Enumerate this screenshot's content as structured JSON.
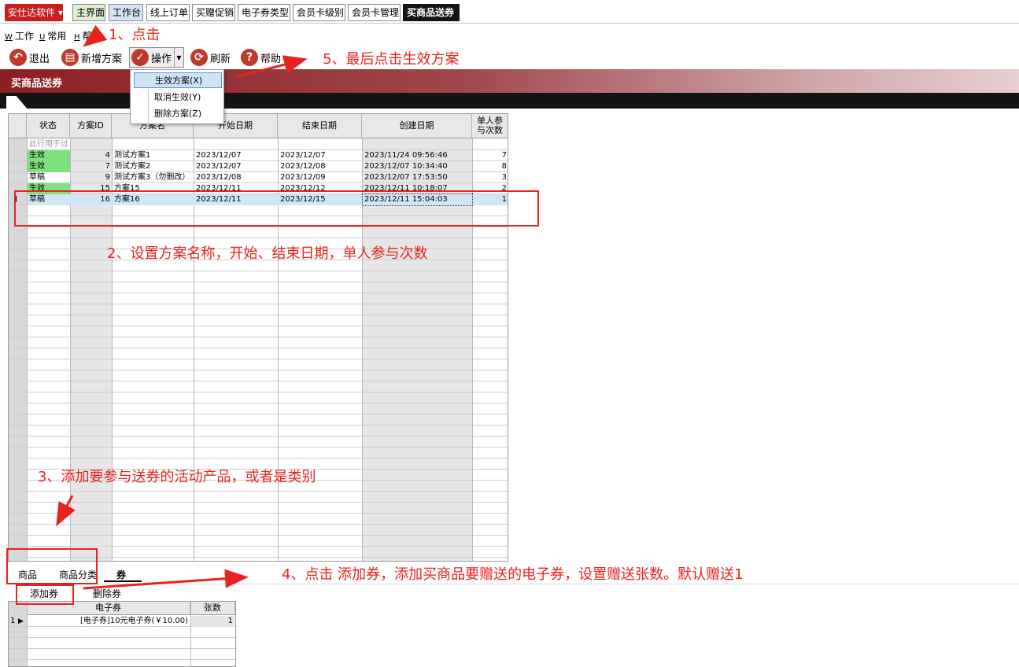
{
  "brand": "安仕达软件",
  "tabs": [
    "主界面",
    "工作台",
    "线上订单",
    "买赠促销",
    "电子券类型",
    "会员卡级别",
    "会员卡管理",
    "买商品送券"
  ],
  "menu": {
    "work": {
      "key": "W",
      "label": "工作"
    },
    "common": {
      "key": "U",
      "label": "常用"
    },
    "help": {
      "key": "H",
      "label": "帮助"
    }
  },
  "toolbar": {
    "exit": "退出",
    "new_plan": "新增方案",
    "operation": "操作",
    "refresh": "刷新",
    "help": "帮助"
  },
  "operation_menu": [
    "生效方案(X)",
    "取消生效(Y)",
    "删除方案(Z)"
  ],
  "panel_title": "买商品送券",
  "grid": {
    "columns": [
      "状态",
      "方案ID",
      "方案名",
      "开始日期",
      "结束日期",
      "创建日期",
      "单人参与次数"
    ],
    "filter_hint": "此行用于过",
    "current_row_marker": "I",
    "rows": [
      {
        "status": "生效",
        "id": "4",
        "name": "测试方案1",
        "start": "2023/12/07",
        "end": "2023/12/07",
        "created": "2023/11/24 09:56:46",
        "times": "7"
      },
      {
        "status": "生效",
        "id": "7",
        "name": "测试方案2",
        "start": "2023/12/07",
        "end": "2023/12/08",
        "created": "2023/12/07 10:34:40",
        "times": "8"
      },
      {
        "status": "草稿",
        "id": "9",
        "name": "测试方案3（勿删改）",
        "start": "2023/12/08",
        "end": "2023/12/09",
        "created": "2023/12/07 17:53:50",
        "times": "3"
      },
      {
        "status": "生效",
        "id": "15",
        "name": "方案15",
        "start": "2023/12/11",
        "end": "2023/12/12",
        "created": "2023/12/11 10:18:07",
        "times": "2"
      },
      {
        "status": "草稿",
        "id": "16",
        "name": "方案16",
        "start": "2023/12/11",
        "end": "2023/12/15",
        "created": "2023/12/11 15:04:03",
        "times": "1"
      }
    ]
  },
  "lower_tabs": [
    "商品",
    "商品分类",
    "券"
  ],
  "lower_toolbar": {
    "add": "添加券",
    "delete": "删除券"
  },
  "voucher_grid": {
    "columns": [
      "电子券",
      "张数"
    ],
    "rows": [
      {
        "idx": "1",
        "voucher": "[电子券]10元电子券(￥10.00)",
        "count": "1"
      }
    ]
  },
  "annotations": {
    "a1": "1、点击",
    "a2": "2、设置方案名称，开始、结束日期，单人参与次数",
    "a3": "3、添加要参与送券的活动产品，或者是类别",
    "a4": "4、点击 添加券，添加买商品要赠送的电子券，设置赠送张数。默认赠送1",
    "a5": "5、最后点击生效方案"
  },
  "colors": {
    "annotation": "#e8231f",
    "active_status": "#7fe07f",
    "selected_row": "#cfe6f7",
    "brand": "#c81e1e"
  }
}
